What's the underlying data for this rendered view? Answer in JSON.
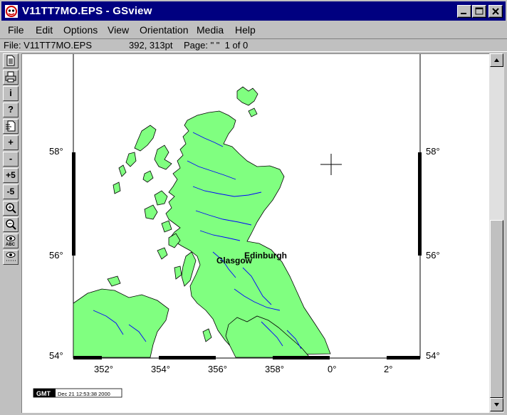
{
  "window": {
    "title": "V11TT7MO.EPS - GSview",
    "app_icon": "gsview-icon",
    "controls": [
      "minimize-icon",
      "maximize-icon",
      "close-icon"
    ]
  },
  "menu": {
    "file": "File",
    "edit": "Edit",
    "options": "Options",
    "view": "View",
    "orientation": "Orientation",
    "media": "Media",
    "help": "Help"
  },
  "status": {
    "file": "File: V11TT7MO.EPS",
    "coords": "392, 313pt",
    "page": "Page: \" \"  1 of 0"
  },
  "toolbar": {
    "open_icon": "document-icon",
    "print_icon": "printer-icon",
    "info": "i",
    "help": "?",
    "goto_icon": "goto-page-icon",
    "next": "+",
    "prev": "-",
    "skip_forward": "+5",
    "skip_back": "-5",
    "zoom_in_icon": "zoom-in-icon",
    "zoom_out_icon": "zoom-out-icon",
    "view_text_icon": "eye-abc-icon",
    "view_dots_icon": "eye-dots-icon"
  },
  "map": {
    "lat_labels": [
      "58°",
      "56°",
      "54°"
    ],
    "lon_labels": [
      "352°",
      "354°",
      "356°",
      "358°",
      "0°",
      "2°"
    ],
    "cities": [
      "Edinburgh",
      "Glasgow"
    ],
    "land_color": "#80ff80",
    "river_color": "#0000ff",
    "gmt_logo": "GMT",
    "timestamp": "Dec 21 12:53:38 2000"
  }
}
